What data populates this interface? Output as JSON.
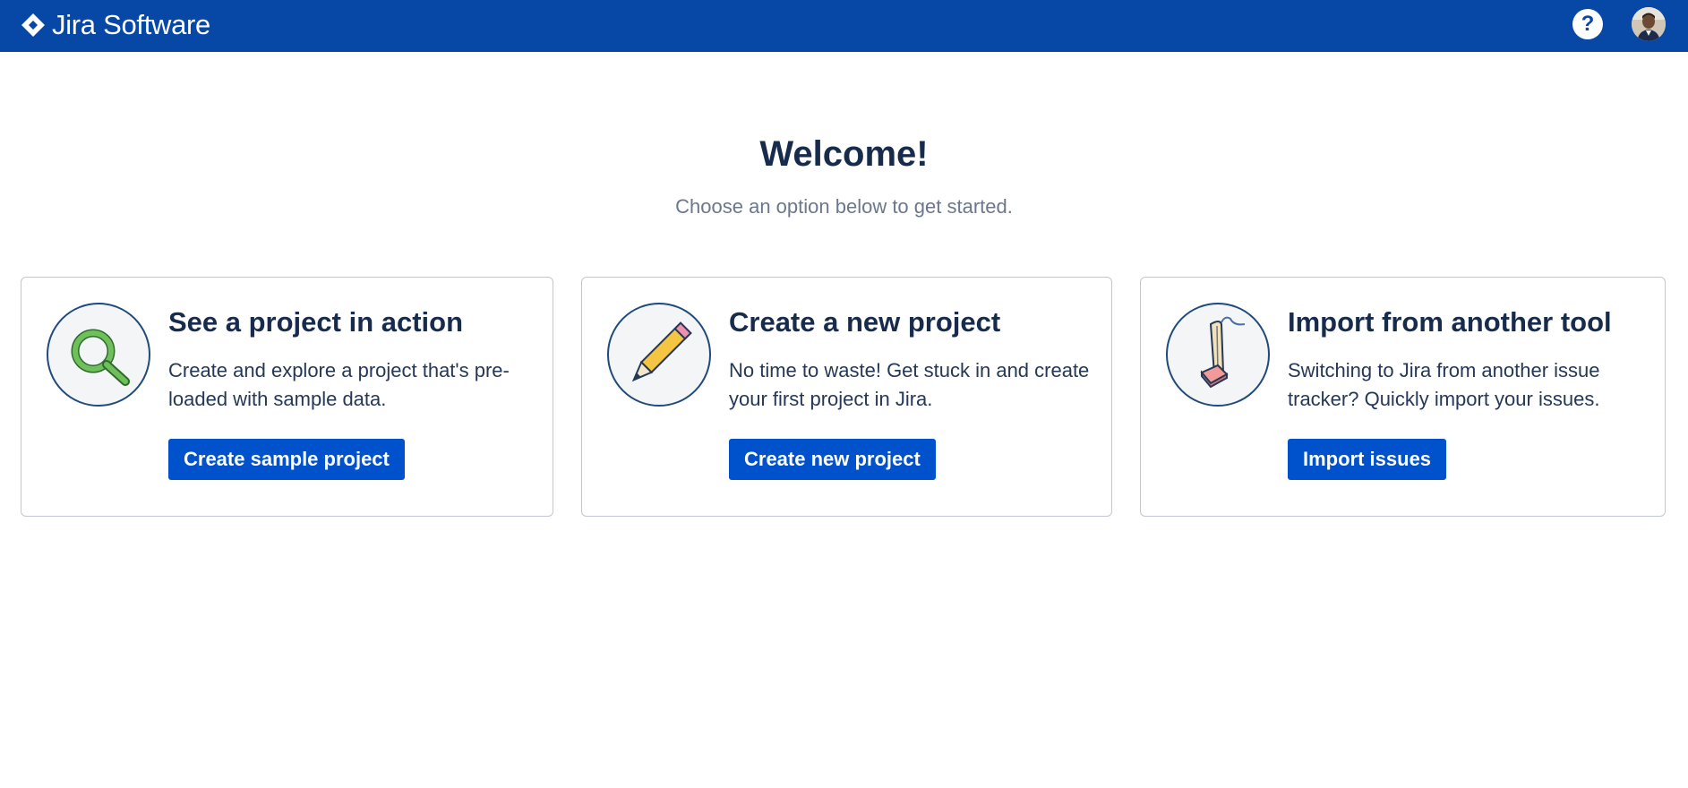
{
  "header": {
    "app_name": "Jira Software",
    "logo_icon": "jira-diamond-icon",
    "help_icon": "question-circle-icon",
    "help_label": "?",
    "avatar_icon": "user-avatar",
    "bar_color": "#0747a6"
  },
  "main": {
    "title": "Welcome!",
    "subtitle": "Choose an option below to get started."
  },
  "cards": [
    {
      "icon": "magnifier-icon",
      "title": "See a project in action",
      "description": "Create and explore a project that's pre-loaded with sample data.",
      "button_label": "Create sample project"
    },
    {
      "icon": "pencil-icon",
      "title": "Create a new project",
      "description": "No time to waste! Get stuck in and create your first project in Jira.",
      "button_label": "Create new project"
    },
    {
      "icon": "vacuum-icon",
      "title": "Import from another tool",
      "description": "Switching to Jira from another issue tracker? Quickly import your issues.",
      "button_label": "Import issues"
    }
  ],
  "colors": {
    "primary_button": "#0052cc",
    "heading": "#172b4d",
    "subtle_text": "#6b778c"
  }
}
